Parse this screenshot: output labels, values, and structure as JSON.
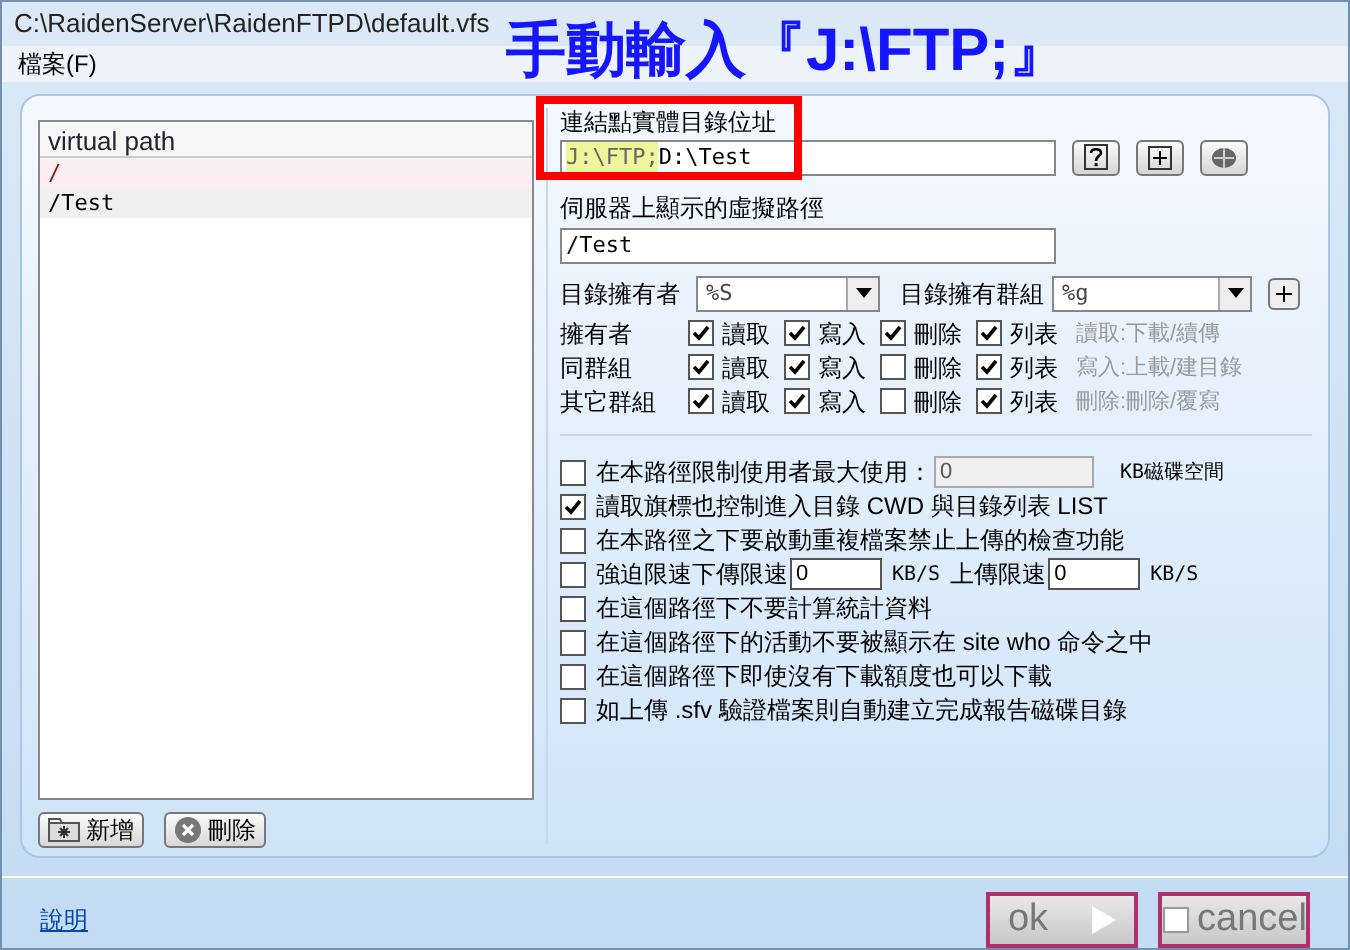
{
  "window": {
    "title": "C:\\RaidenServer\\RaidenFTPD\\default.vfs"
  },
  "menu": [
    "檔案(F)"
  ],
  "annotation": {
    "text": "手動輸入『J:\\FTP;』"
  },
  "path_list": {
    "header": "virtual path",
    "items": [
      {
        "label": "/",
        "selected": true
      },
      {
        "label": "/Test",
        "selected": false
      }
    ]
  },
  "list_buttons": [
    "新增",
    "刪除"
  ],
  "physical_path": {
    "label": "連結點實體目錄位址",
    "highlight": "J:\\FTP;",
    "value": "D:\\Test"
  },
  "virtual_path": {
    "label": "伺服器上顯示的虛擬路徑",
    "value": "/Test"
  },
  "owner": {
    "label": "目錄擁有者",
    "value": "%S"
  },
  "group": {
    "label": "目錄擁有群組",
    "value": "%g"
  },
  "permissions": [
    {
      "who": "擁有者",
      "perms": [
        {
          "label": "讀取",
          "checked": true
        },
        {
          "label": "寫入",
          "checked": true
        },
        {
          "label": "刪除",
          "checked": true
        },
        {
          "label": "列表",
          "checked": true
        }
      ],
      "hint": "讀取:下載/續傳"
    },
    {
      "who": "同群組",
      "perms": [
        {
          "label": "讀取",
          "checked": true
        },
        {
          "label": "寫入",
          "checked": true
        },
        {
          "label": "刪除",
          "checked": false
        },
        {
          "label": "列表",
          "checked": true
        }
      ],
      "hint": "寫入:上載/建目錄"
    },
    {
      "who": "其它群組",
      "perms": [
        {
          "label": "讀取",
          "checked": true
        },
        {
          "label": "寫入",
          "checked": true
        },
        {
          "label": "刪除",
          "checked": false
        },
        {
          "label": "列表",
          "checked": true
        }
      ],
      "hint": "刪除:刪除/覆寫"
    }
  ],
  "options": [
    {
      "kind": "quota",
      "label": "在本路徑限制使用者最大使用：",
      "checked": false,
      "value": "0",
      "unit": "KB磁碟空間"
    },
    {
      "kind": "plain",
      "label": "讀取旗標也控制進入目錄 CWD 與目錄列表 LIST",
      "checked": true
    },
    {
      "kind": "plain",
      "label": "在本路徑之下要啟動重複檔案禁止上傳的檢查功能",
      "checked": false
    },
    {
      "kind": "speed",
      "label": "強迫限速下傳限速",
      "checked": false,
      "value": "0",
      "unit": "KB/S",
      "label2": "上傳限速",
      "value2": "0",
      "unit2": "KB/S"
    },
    {
      "kind": "plain",
      "label": "在這個路徑下不要計算統計資料",
      "checked": false
    },
    {
      "kind": "plain",
      "label": "在這個路徑下的活動不要被顯示在 site who 命令之中",
      "checked": false
    },
    {
      "kind": "plain",
      "label": "在這個路徑下即使沒有下載額度也可以下載",
      "checked": false
    },
    {
      "kind": "plain",
      "label": "如上傳 .sfv 驗證檔案則自動建立完成報告磁碟目錄",
      "checked": false
    }
  ],
  "help_link": "說明",
  "buttons": [
    {
      "label": "ok"
    },
    {
      "label": "cancel"
    }
  ]
}
